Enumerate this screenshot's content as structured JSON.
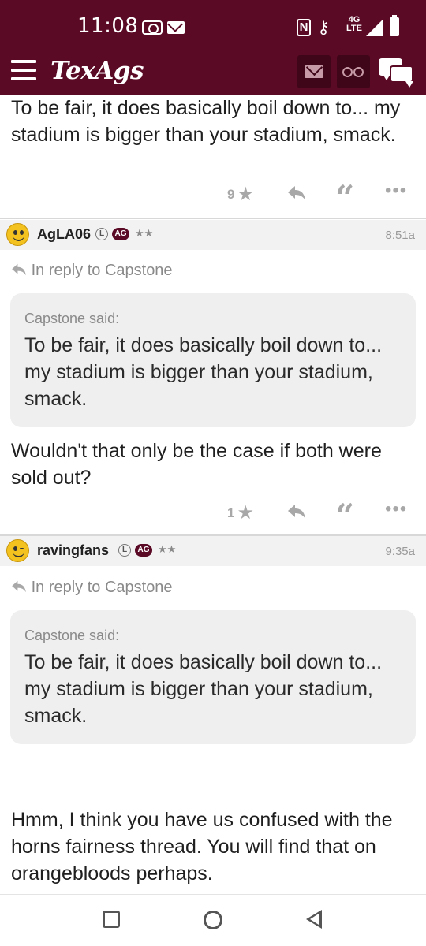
{
  "status_bar": {
    "time": "11:08",
    "network": "4G LTE"
  },
  "app": {
    "brand": "TexAgs"
  },
  "posts": [
    {
      "body": "To be fair, it does basically boil down to... my stadium is bigger than your stadium, smack.",
      "star_count": "9"
    },
    {
      "username": "AgLA06",
      "badge_l": "L",
      "badge_ag": "AG",
      "rank_stars": "★★",
      "time": "8:51a",
      "in_reply_to": "In reply to Capstone",
      "quote_author": "Capstone said:",
      "quote_text": "To be fair, it does basically boil down to... my stadium is bigger than your stadium, smack.",
      "body": "Wouldn't that only be the case if both were sold out?",
      "star_count": "1"
    },
    {
      "username": "ravingfans",
      "badge_l": "L",
      "badge_ag": "AG",
      "rank_stars": "★★",
      "time": "9:35a",
      "in_reply_to": "In reply to Capstone",
      "quote_author": "Capstone said:",
      "quote_text": "To be fair, it does basically boil down to... my stadium is bigger than your stadium, smack.",
      "body": "Hmm, I think you have us confused with the horns fairness thread. You will find that on orangebloods perhaps."
    }
  ],
  "icons": {
    "star": "★",
    "reply": "reply-arrow-icon",
    "quote": "“",
    "more": "•••"
  },
  "colors": {
    "brand_maroon": "#5b0a26",
    "action_gray": "#a8a8a8"
  }
}
